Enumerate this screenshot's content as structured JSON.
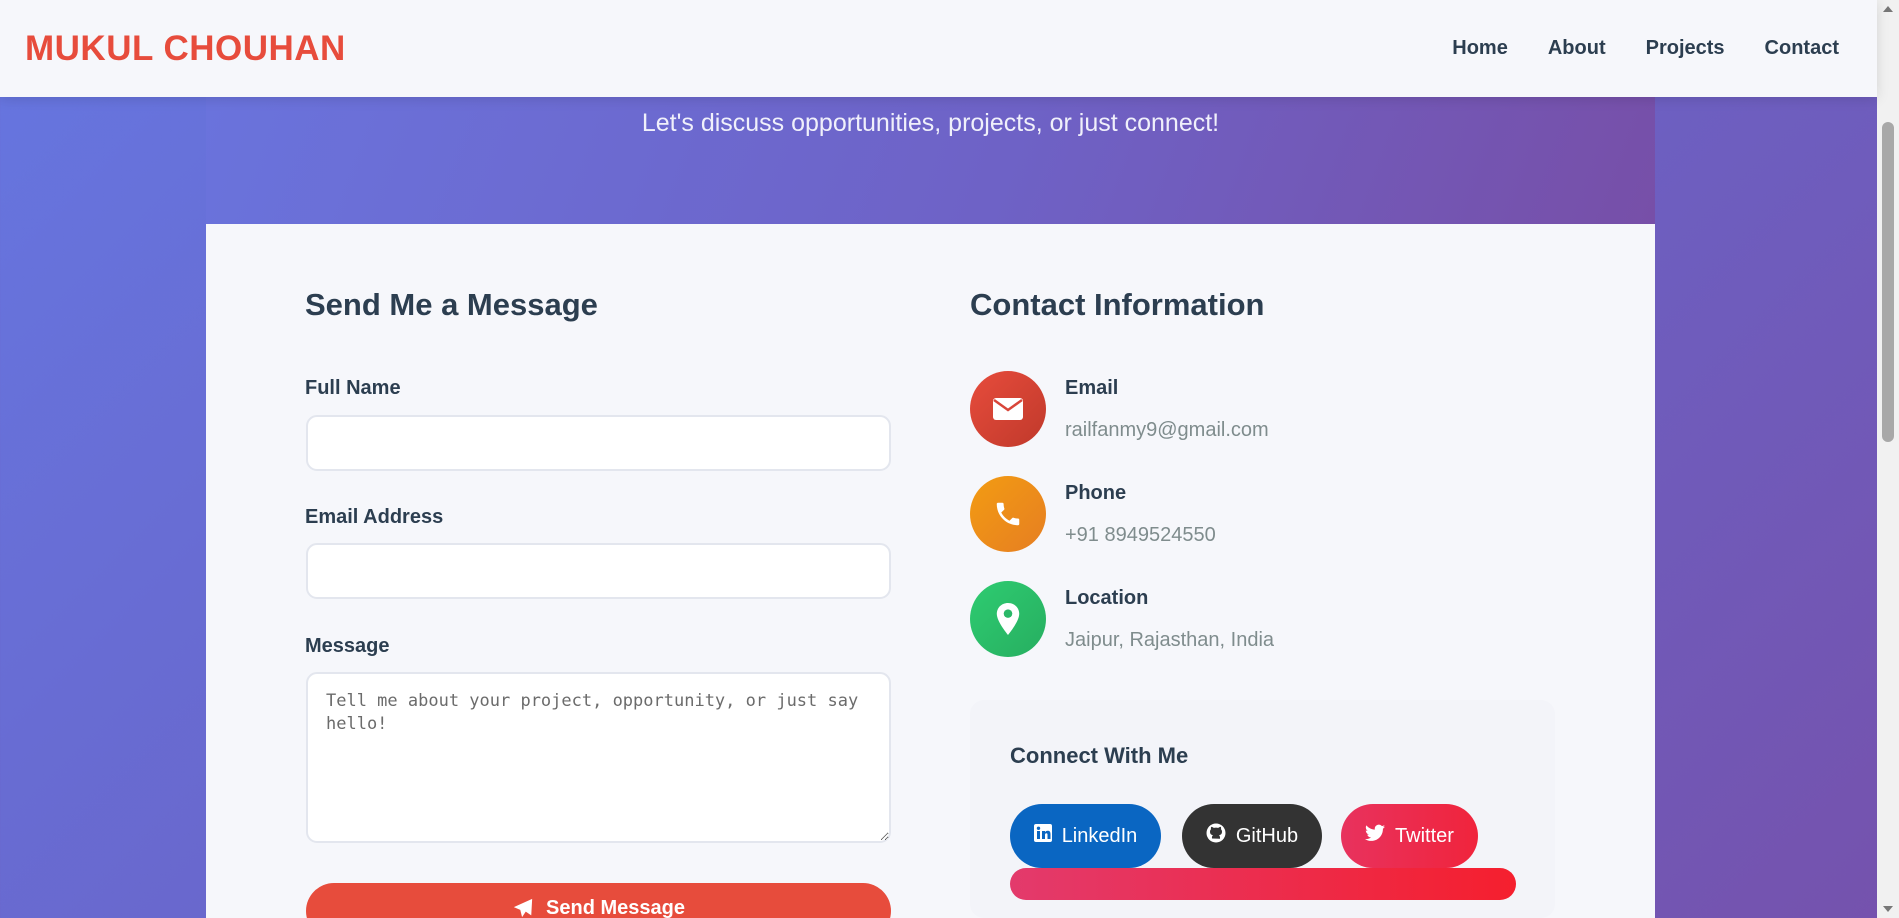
{
  "header": {
    "brand": "MUKUL CHOUHAN",
    "nav": [
      "Home",
      "About",
      "Projects",
      "Contact"
    ]
  },
  "hero": {
    "subtitle": "Let's discuss opportunities, projects, or just connect!"
  },
  "form": {
    "title": "Send Me a Message",
    "name_label": "Full Name",
    "name_value": "",
    "email_label": "Email Address",
    "email_value": "",
    "message_label": "Message",
    "message_placeholder": "Tell me about your project, opportunity, or just say hello!",
    "submit_label": "Send Message"
  },
  "contact": {
    "title": "Contact Information",
    "items": [
      {
        "title": "Email",
        "value": "railfanmy9@gmail.com",
        "icon": "envelope-icon",
        "color": "#e74c3c"
      },
      {
        "title": "Phone",
        "value": "+91 8949524550",
        "icon": "phone-icon",
        "color": "#f39c12"
      },
      {
        "title": "Location",
        "value": "Jaipur, Rajasthan, India",
        "icon": "map-pin-icon",
        "color": "#2ecc71"
      }
    ]
  },
  "connect": {
    "title": "Connect With Me",
    "links": [
      {
        "label": "LinkedIn",
        "icon": "linkedin-icon",
        "color": "#0a66c2"
      },
      {
        "label": "GitHub",
        "icon": "github-icon",
        "color": "#333333"
      },
      {
        "label": "Twitter",
        "icon": "twitter-icon",
        "color": "#e8325e"
      }
    ]
  },
  "colors": {
    "accent": "#e74c3c",
    "text": "#2c3e50",
    "muted": "#7f8c8d"
  }
}
